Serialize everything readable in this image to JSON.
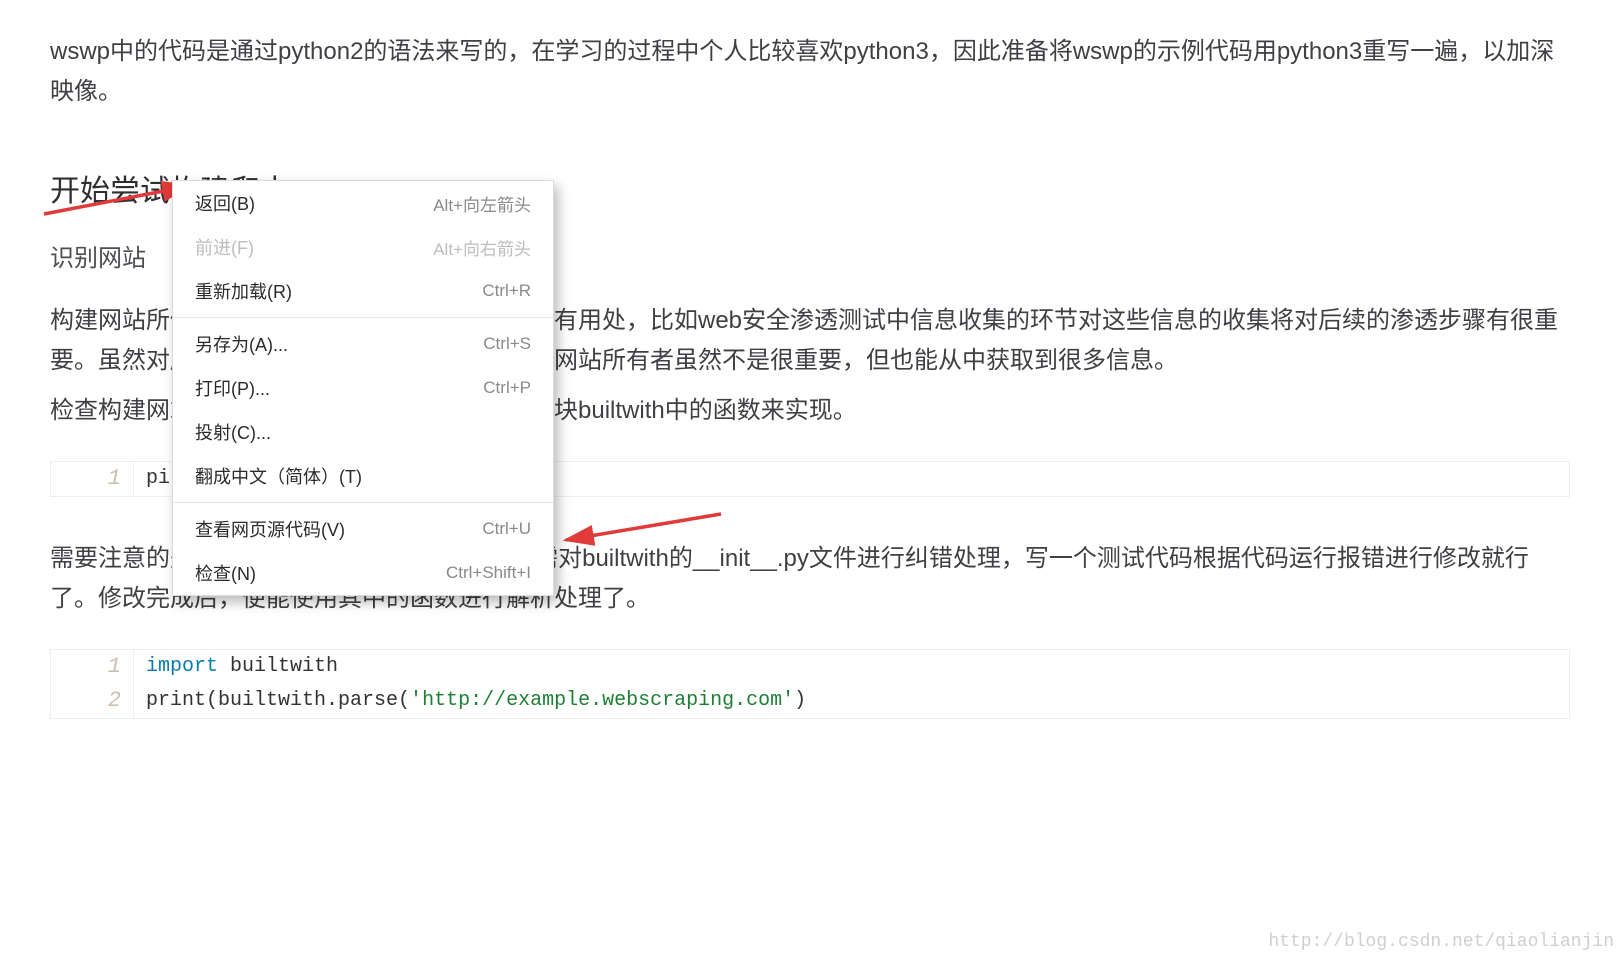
{
  "body": {
    "p1": "wswp中的代码是通过python2的语法来写的，在学习的过程中个人比较喜欢python3，因此准备将wswp的示例代码用python3重写一遍，以加深映像。",
    "h2": "开始尝试构建爬虫",
    "h3_partial": "识别网站",
    "p2": "构建网站所使用的技术和寻找网站所有者有着很有用处，比如web安全渗透测试中信息收集的环节对这些信息的收集将对后续的渗透步骤有很重要。虽然对爬虫来说，识别网站所使用的技术和网站所有者虽然不是很重要，但也能从中获取到很多信息。",
    "p2b": "检查构建网站的技术类型可通过一个很有用的模块builtwith中的函数来实现。",
    "p3": "需要注意的是，python3中安装好builtwith以后需对builtwith的__init__.py文件进行纠错处理，写一个测试代码根据代码运行报错进行修改就行了。修改完成后，便能使用其中的函数进行解析处理了。"
  },
  "code1": {
    "ln": "1",
    "text": "pi"
  },
  "code2": {
    "l1": {
      "ln": "1",
      "kw": "import",
      "rest": " builtwith"
    },
    "l2": {
      "ln": "2",
      "a": "print(builtwith.parse(",
      "q1": "'",
      "url": "http://example.webscraping.com",
      "q2": "'",
      "b": ")"
    }
  },
  "menu": {
    "items": [
      {
        "label": "返回(B)",
        "shortcut": "Alt+向左箭头",
        "disabled": false
      },
      {
        "label": "前进(F)",
        "shortcut": "Alt+向右箭头",
        "disabled": true
      },
      {
        "label": "重新加载(R)",
        "shortcut": "Ctrl+R",
        "disabled": false
      },
      {
        "sep": true
      },
      {
        "label": "另存为(A)...",
        "shortcut": "Ctrl+S",
        "disabled": false
      },
      {
        "label": "打印(P)...",
        "shortcut": "Ctrl+P",
        "disabled": false
      },
      {
        "label": "投射(C)...",
        "shortcut": "",
        "disabled": false
      },
      {
        "label": "翻成中文（简体）(T)",
        "shortcut": "",
        "disabled": false
      },
      {
        "sep": true
      },
      {
        "label": "查看网页源代码(V)",
        "shortcut": "Ctrl+U",
        "disabled": false
      },
      {
        "label": "检查(N)",
        "shortcut": "Ctrl+Shift+I",
        "disabled": false
      }
    ]
  },
  "watermark": "http://blog.csdn.net/qiaolianjin",
  "colors": {
    "arrow": "#e03a3a",
    "keyword": "#0a7ea8",
    "string": "#1e7f34"
  }
}
